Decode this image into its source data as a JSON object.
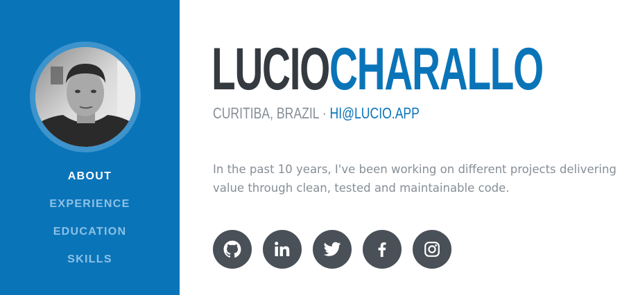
{
  "profile": {
    "first_name": "LUCIO",
    "last_name": "CHARALLO",
    "location": "CURITIBA, BRAZIL",
    "separator": "·",
    "email": "HI@LUCIO.APP",
    "bio": "In the past 10 years, I've been working on different projects delivering value through clean, tested and maintainable code."
  },
  "nav": {
    "items": [
      {
        "label": "ABOUT",
        "active": true
      },
      {
        "label": "EXPERIENCE",
        "active": false
      },
      {
        "label": "EDUCATION",
        "active": false
      },
      {
        "label": "SKILLS",
        "active": false
      }
    ]
  },
  "social": [
    {
      "icon": "github-icon"
    },
    {
      "icon": "linkedin-icon"
    },
    {
      "icon": "twitter-icon"
    },
    {
      "icon": "facebook-icon"
    },
    {
      "icon": "instagram-icon"
    }
  ],
  "colors": {
    "primary": "#0a74b8",
    "sidebar_ring": "#3d93cc",
    "nav_inactive": "#8cc2e6",
    "heading_dark": "#343a40",
    "muted_text": "#868e96",
    "social_bg": "#495057"
  }
}
